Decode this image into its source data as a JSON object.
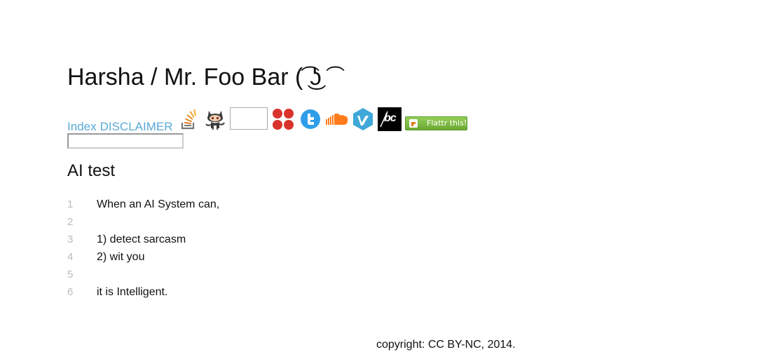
{
  "header": {
    "site_title": "Harsha / Mr. Foo Bar (͡ ͜ʖ ͡"
  },
  "nav": {
    "index_label": "Index",
    "disclaimer_label": "DISCLAIMER",
    "icons": [
      "stackoverflow-icon",
      "github-octocat-icon",
      "blank-box-icon",
      "four-dots-icon",
      "twitter-icon",
      "soundcloud-icon",
      "vimeo-icon",
      "bandcamp-icon",
      "flattr-icon"
    ],
    "flattr_label": "Flattr this!",
    "bandcamp_label": "bc"
  },
  "search": {
    "value": ""
  },
  "post": {
    "title": "AI test",
    "lines": [
      {
        "no": "1",
        "text": "When an AI System can,"
      },
      {
        "no": "2",
        "text": ""
      },
      {
        "no": "3",
        "text": "1) detect sarcasm"
      },
      {
        "no": "4",
        "text": "2) wit you"
      },
      {
        "no": "5",
        "text": ""
      },
      {
        "no": "6",
        "text": "it is Intelligent."
      }
    ]
  },
  "footer": {
    "copyright": "copyright: CC BY-NC, 2014."
  },
  "colors": {
    "link": "#58a9d6",
    "twitter": "#2e9ee8",
    "soundcloud": "#ff7a1a",
    "vimeo": "#3fa8d8",
    "dots": "#d9332c",
    "flattr": "#7cbf3a"
  }
}
